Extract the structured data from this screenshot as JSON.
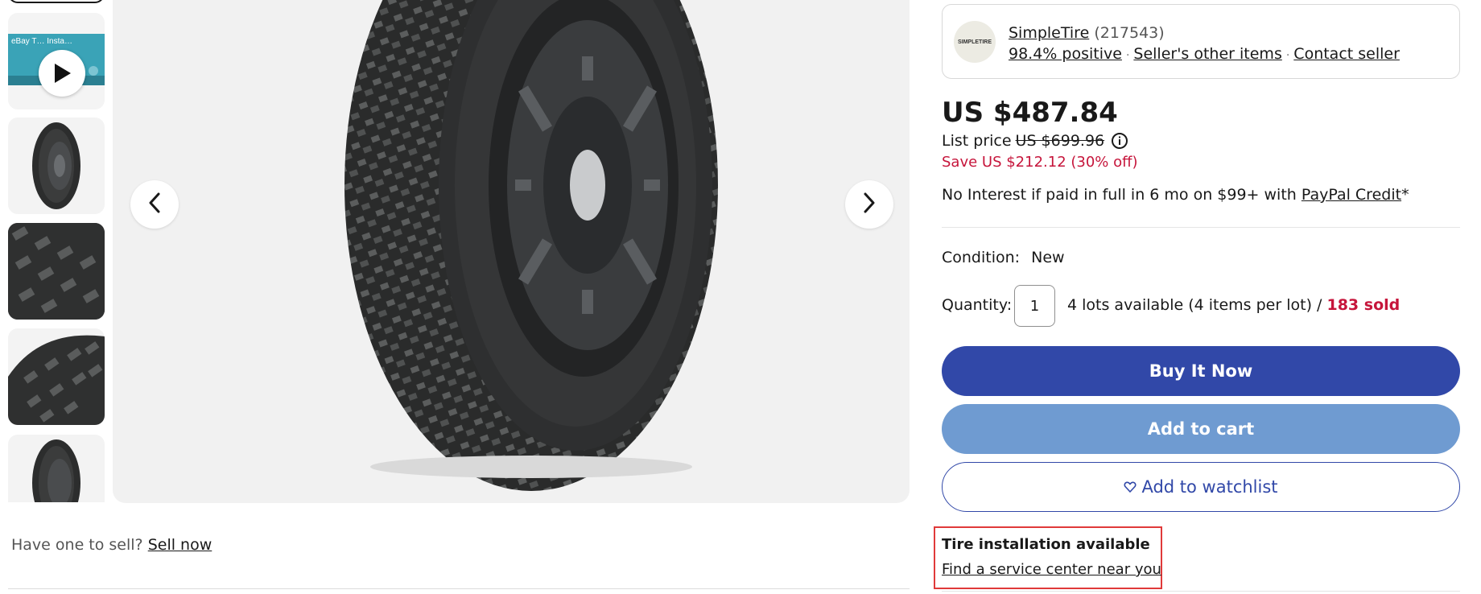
{
  "thumbnails": {
    "video_label": "eBay T… Insta…",
    "items": [
      {
        "kind": "video",
        "name": "video-thumbnail"
      },
      {
        "kind": "tire",
        "name": "tire-thumbnail-1"
      },
      {
        "kind": "tread",
        "name": "tread-thumbnail-2"
      },
      {
        "kind": "tread",
        "name": "tread-thumbnail-3"
      },
      {
        "kind": "tire",
        "name": "tire-thumbnail-4"
      }
    ]
  },
  "main_image": {
    "prev_icon": "chevron-left-icon",
    "next_icon": "chevron-right-icon"
  },
  "seller": {
    "logo_text": "SIMPLETIRE",
    "name": "SimpleTire",
    "feedback_count": "(217543)",
    "positive": "98.4% positive",
    "other_items": "Seller's other items",
    "contact": "Contact seller"
  },
  "pricing": {
    "price": "US $487.84",
    "list_price_label": "List price",
    "list_price": "US $699.96",
    "save": "Save US $212.12 (30% off)",
    "financing_text": "No Interest if paid in full in 6 mo on $99+ with ",
    "financing_link": "PayPal Credit",
    "financing_suffix": "*"
  },
  "condition": {
    "label": "Condition:",
    "value": "New"
  },
  "quantity": {
    "label": "Quantity:",
    "value": "1",
    "available": "4 lots available (4 items per lot) / ",
    "sold": "183 sold"
  },
  "actions": {
    "buy_now": "Buy It Now",
    "add_to_cart": "Add to cart",
    "watchlist": "Add to watchlist"
  },
  "installation": {
    "title": "Tire installation available",
    "link": "Find a service center near you"
  },
  "sell": {
    "question": "Have one to sell?",
    "link": "Sell now"
  },
  "colors": {
    "primary_button": "#3148a8",
    "secondary_button": "#6f9bd1",
    "sale_red": "#c6153b",
    "highlight_box": "#e03a3a"
  }
}
